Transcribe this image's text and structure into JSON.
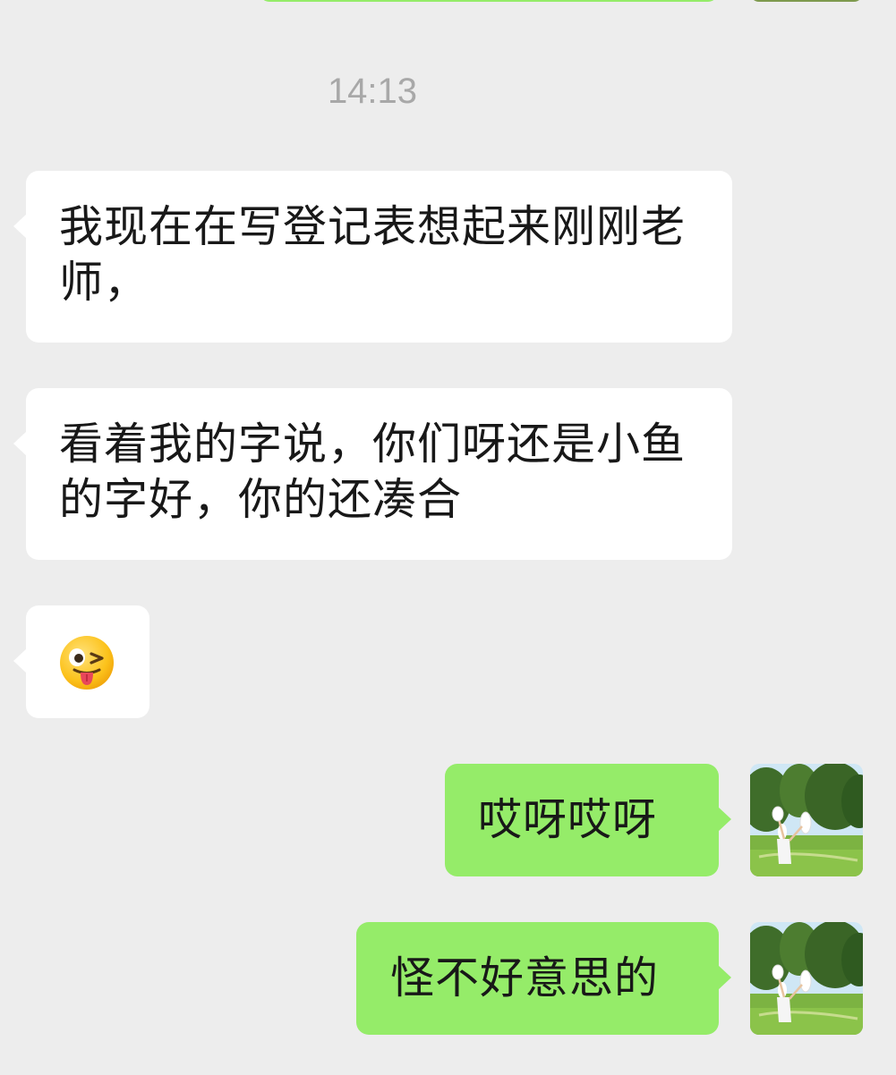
{
  "conversation": {
    "timestamp": "14:13",
    "messages": [
      {
        "side": "incoming",
        "text": "我现在在写登记表想起来刚刚老师，"
      },
      {
        "side": "incoming",
        "text": "看着我的字说，你们呀还是小鱼的字好，你的还凑合"
      },
      {
        "side": "incoming",
        "emoji": "winking-tongue-face",
        "text": "😜"
      },
      {
        "side": "outgoing",
        "text": "哎呀哎呀"
      },
      {
        "side": "outgoing",
        "text": "怪不好意思的"
      }
    ]
  },
  "colors": {
    "background": "#ededed",
    "incoming_bubble": "#ffffff",
    "outgoing_bubble": "#95ec69",
    "timestamp_text": "#a8a8a8"
  },
  "avatar": {
    "description_icon": "user-avatar-photo"
  }
}
